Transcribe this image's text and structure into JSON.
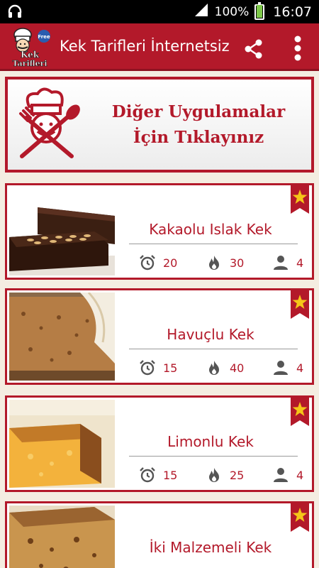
{
  "status_bar": {
    "headphone_icon": "headphones-icon",
    "battery_percent": "100%",
    "battery_level": 1.0,
    "time": "16:07"
  },
  "app_bar": {
    "logo_text_top": "Kek",
    "logo_text_bottom": "Tarifleri",
    "logo_badge": "Free",
    "title": "Kek Tarifleri İnternetsiz",
    "share_icon": "share-icon",
    "menu_icon": "overflow-menu-icon"
  },
  "banner": {
    "line1": "Diğer Uygulamalar",
    "line2": "İçin Tıklayınız"
  },
  "recipes": [
    {
      "title": "Kakaolu Islak Kek",
      "time": "20",
      "heat": "30",
      "servings": "4"
    },
    {
      "title": "Havuçlu Kek",
      "time": "15",
      "heat": "40",
      "servings": "4"
    },
    {
      "title": "Limonlu Kek",
      "time": "15",
      "heat": "25",
      "servings": "4"
    },
    {
      "title": "İki Malzemeli Kek",
      "time": "",
      "heat": "",
      "servings": ""
    }
  ],
  "colors": {
    "primary": "#b3192a",
    "background": "#f4ede1",
    "star": "#f5c518"
  }
}
